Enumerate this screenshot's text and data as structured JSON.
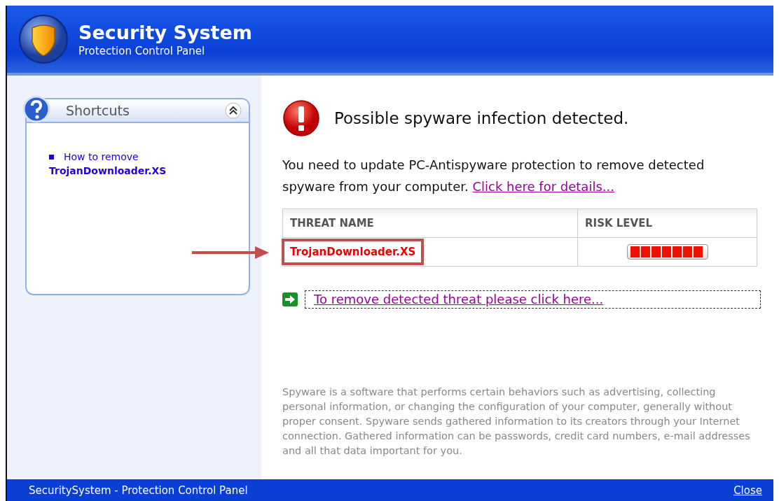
{
  "header": {
    "title": "Security System",
    "subtitle": "Protection Control Panel"
  },
  "shortcuts": {
    "title": "Shortcuts",
    "expanded": true,
    "items": [
      {
        "text": "How to remove",
        "bold_text": "TrojanDownloader.XS"
      }
    ]
  },
  "alert": {
    "title": "Possible spyware infection detected.",
    "message": "You need to update PC-Antispyware protection to remove detected spyware from your computer.",
    "link": "Click here for details..."
  },
  "table": {
    "columns": [
      "THREAT NAME",
      "RISK LEVEL"
    ],
    "rows": [
      {
        "name": "TrojanDownloader.XS",
        "highlighted": true,
        "level": 1.0
      }
    ]
  },
  "remove_link": "To remove detected threat please click here...",
  "description": "Spyware is a software that performs certain behaviors such as advertising, collecting personal information, or changing the configuration of your computer, generally without proper consent. Spyware sends gathered information to its creators through your Internet connection. Gathered information can be passwords, credit card numbers, e-mail addresses and all that data important for you.",
  "status_bar": {
    "text": "SecuritySystem - Protection Control Panel",
    "close": "Close"
  }
}
